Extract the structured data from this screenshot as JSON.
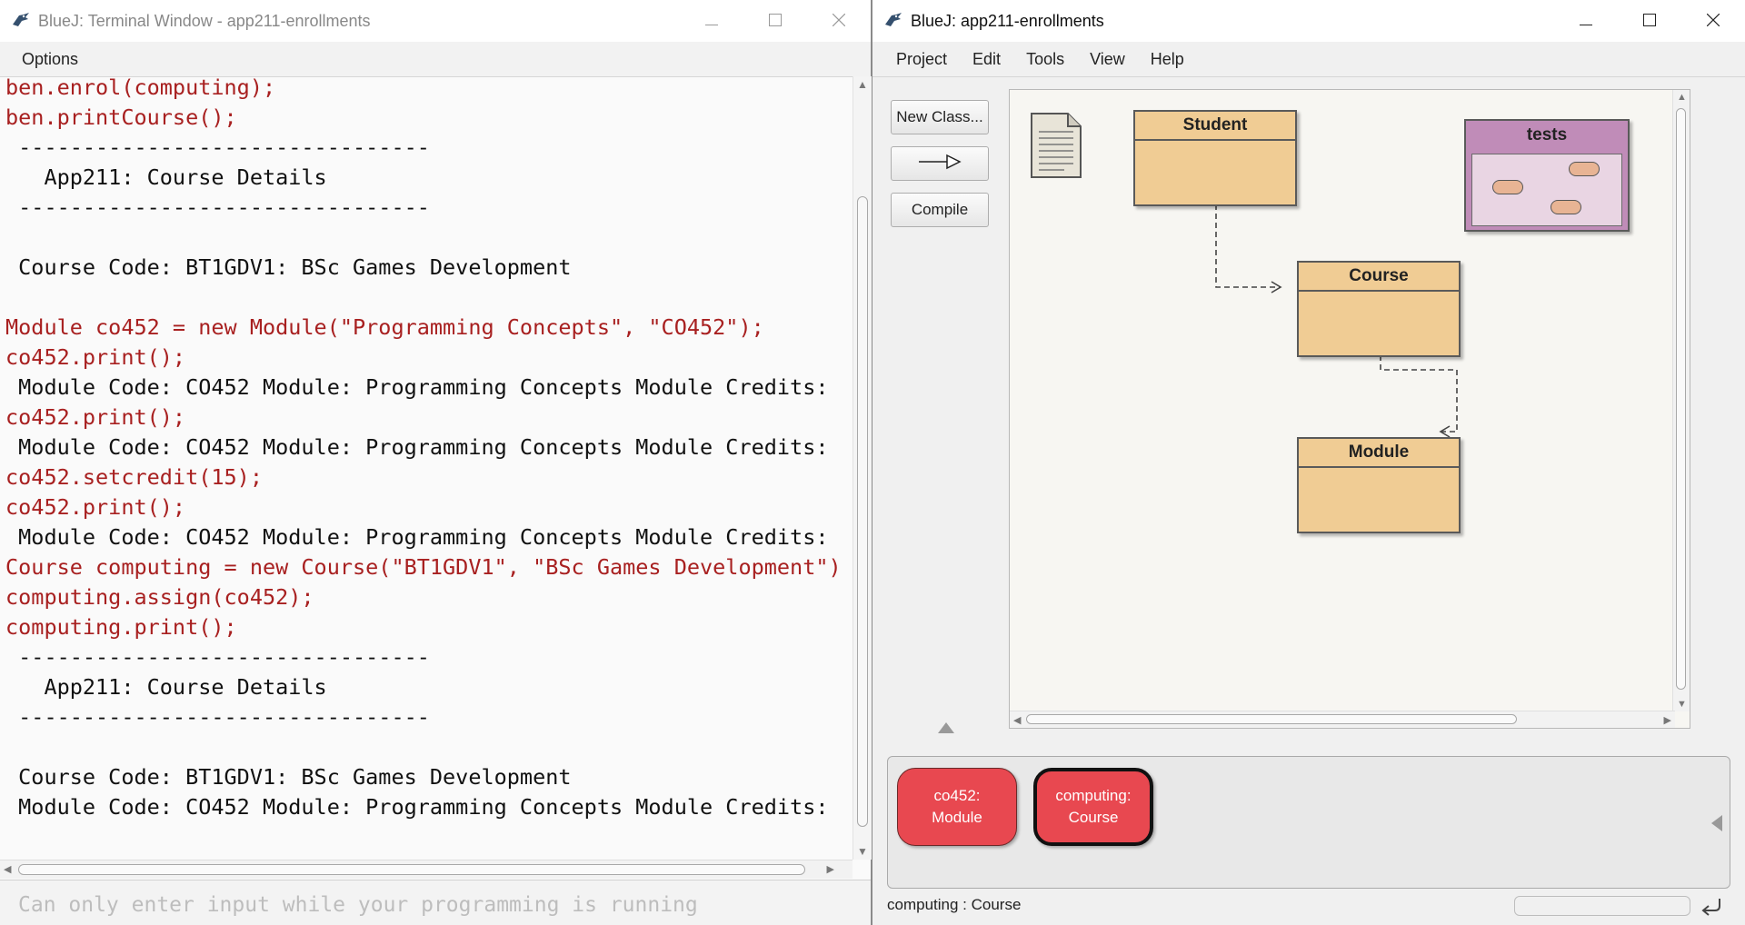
{
  "terminal": {
    "title": "BlueJ: Terminal Window - app211-enrollments",
    "menu": [
      "Options"
    ],
    "lines": [
      {
        "kind": "in",
        "text": "ben.enrol(computing);"
      },
      {
        "kind": "in",
        "text": "ben.printCourse();"
      },
      {
        "kind": "out",
        "text": " --------------------------------"
      },
      {
        "kind": "out",
        "text": "   App211: Course Details"
      },
      {
        "kind": "out",
        "text": " --------------------------------"
      },
      {
        "kind": "out",
        "text": ""
      },
      {
        "kind": "out",
        "text": " Course Code: BT1GDV1: BSc Games Development"
      },
      {
        "kind": "out",
        "text": ""
      },
      {
        "kind": "in",
        "text": "Module co452 = new Module(\"Programming Concepts\", \"CO452\");"
      },
      {
        "kind": "in",
        "text": "co452.print();"
      },
      {
        "kind": "out",
        "text": " Module Code: CO452 Module: Programming Concepts Module Credits: "
      },
      {
        "kind": "in",
        "text": "co452.print();"
      },
      {
        "kind": "out",
        "text": " Module Code: CO452 Module: Programming Concepts Module Credits: "
      },
      {
        "kind": "in",
        "text": "co452.setcredit(15);"
      },
      {
        "kind": "in",
        "text": "co452.print();"
      },
      {
        "kind": "out",
        "text": " Module Code: CO452 Module: Programming Concepts Module Credits: "
      },
      {
        "kind": "in",
        "text": "Course computing = new Course(\"BT1GDV1\", \"BSc Games Development\")"
      },
      {
        "kind": "in",
        "text": "computing.assign(co452);"
      },
      {
        "kind": "in",
        "text": "computing.print();"
      },
      {
        "kind": "out",
        "text": " --------------------------------"
      },
      {
        "kind": "out",
        "text": "   App211: Course Details"
      },
      {
        "kind": "out",
        "text": " --------------------------------"
      },
      {
        "kind": "out",
        "text": ""
      },
      {
        "kind": "out",
        "text": " Course Code: BT1GDV1: BSc Games Development"
      },
      {
        "kind": "out",
        "text": " Module Code: CO452 Module: Programming Concepts Module Credits: "
      }
    ],
    "input_placeholder": "Can only enter input while your programming is running"
  },
  "bluej": {
    "title": "BlueJ:  app211-enrollments",
    "menu": [
      "Project",
      "Edit",
      "Tools",
      "View",
      "Help"
    ],
    "tool_buttons": {
      "new_class": "New Class...",
      "compile": "Compile"
    },
    "classes": {
      "student": "Student",
      "course": "Course",
      "module": "Module"
    },
    "package_name": "tests",
    "objects": [
      {
        "line1": "co452:",
        "line2": "Module",
        "selected": false
      },
      {
        "line1": "computing:",
        "line2": "Course",
        "selected": true
      }
    ],
    "status": "computing : Course"
  },
  "colors": {
    "input_text": "#a82020",
    "class_fill": "#f0cc94",
    "package_fill": "#c08cb8",
    "object_fill": "#e84850"
  }
}
